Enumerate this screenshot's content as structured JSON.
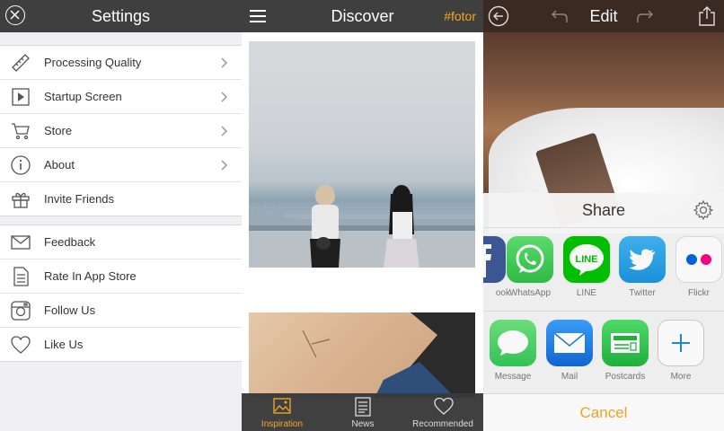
{
  "settings": {
    "title": "Settings",
    "group1": [
      {
        "label": "Processing Quality",
        "icon": "ruler-icon"
      },
      {
        "label": "Startup Screen",
        "icon": "play-icon"
      },
      {
        "label": "Store",
        "icon": "cart-icon"
      },
      {
        "label": "About",
        "icon": "info-icon"
      },
      {
        "label": "Invite Friends",
        "icon": "gift-icon"
      }
    ],
    "group2": [
      {
        "label": "Feedback",
        "icon": "mail-icon"
      },
      {
        "label": "Rate In App Store",
        "icon": "document-icon"
      },
      {
        "label": "Follow Us",
        "icon": "instagram-icon"
      },
      {
        "label": "Like Us",
        "icon": "heart-icon"
      }
    ]
  },
  "discover": {
    "title": "Discover",
    "brand": "#fotor",
    "tabs": [
      {
        "label": "Inspiration",
        "icon": "image-icon"
      },
      {
        "label": "News",
        "icon": "news-icon"
      },
      {
        "label": "Recommended",
        "icon": "heart-icon"
      }
    ]
  },
  "edit": {
    "title": "Edit",
    "share": {
      "title": "Share",
      "apps": [
        {
          "label": "ook",
          "color": "#3b5998"
        },
        {
          "label": "WhatsApp",
          "color": "#4cd964"
        },
        {
          "label": "LINE",
          "color": "#00c300"
        },
        {
          "label": "Twitter",
          "color": "#1da1f2"
        },
        {
          "label": "Flickr",
          "color": "#ffffff"
        }
      ],
      "actions": [
        {
          "label": "Message",
          "color": "#4cd964"
        },
        {
          "label": "Mail",
          "color": "#1e88e5"
        },
        {
          "label": "Postcards",
          "color": "#2ecc40"
        },
        {
          "label": "More",
          "color": "#ffffff"
        }
      ],
      "cancel": "Cancel"
    }
  },
  "colors": {
    "accent": "#f5a623",
    "topbar": "#3f3f3f"
  }
}
